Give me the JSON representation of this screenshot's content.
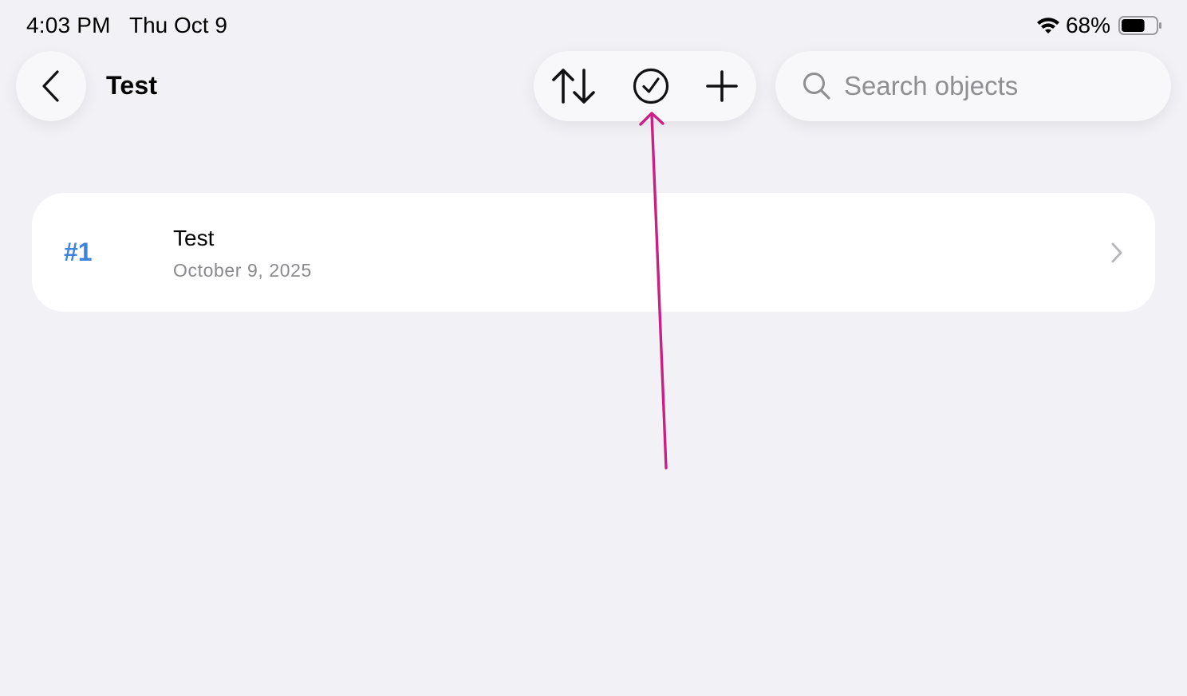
{
  "status_bar": {
    "time": "4:03 PM",
    "date": "Thu Oct 9",
    "battery_percent": "68%",
    "battery_level": 0.68,
    "icons": [
      "wifi-icon",
      "battery-icon"
    ]
  },
  "header": {
    "back_icon": "chevron-left-icon",
    "title": "Test"
  },
  "toolbar": {
    "icons": [
      "sort-arrows-icon",
      "checkmark-circle-icon",
      "plus-icon"
    ]
  },
  "search": {
    "placeholder": "Search objects",
    "value": "",
    "icon": "magnifying-glass-icon"
  },
  "list": {
    "items": [
      {
        "index": "#1",
        "title": "Test",
        "date": "October 9, 2025",
        "chevron_icon": "chevron-right-icon"
      }
    ]
  },
  "annotation": {
    "type": "arrow",
    "target": "checkmark-circle-icon",
    "color": "#cc1f83"
  },
  "colors": {
    "background": "#f2f1f6",
    "card": "#ffffff",
    "accent": "#3d82dd",
    "secondary_text": "#8a8a8e"
  }
}
